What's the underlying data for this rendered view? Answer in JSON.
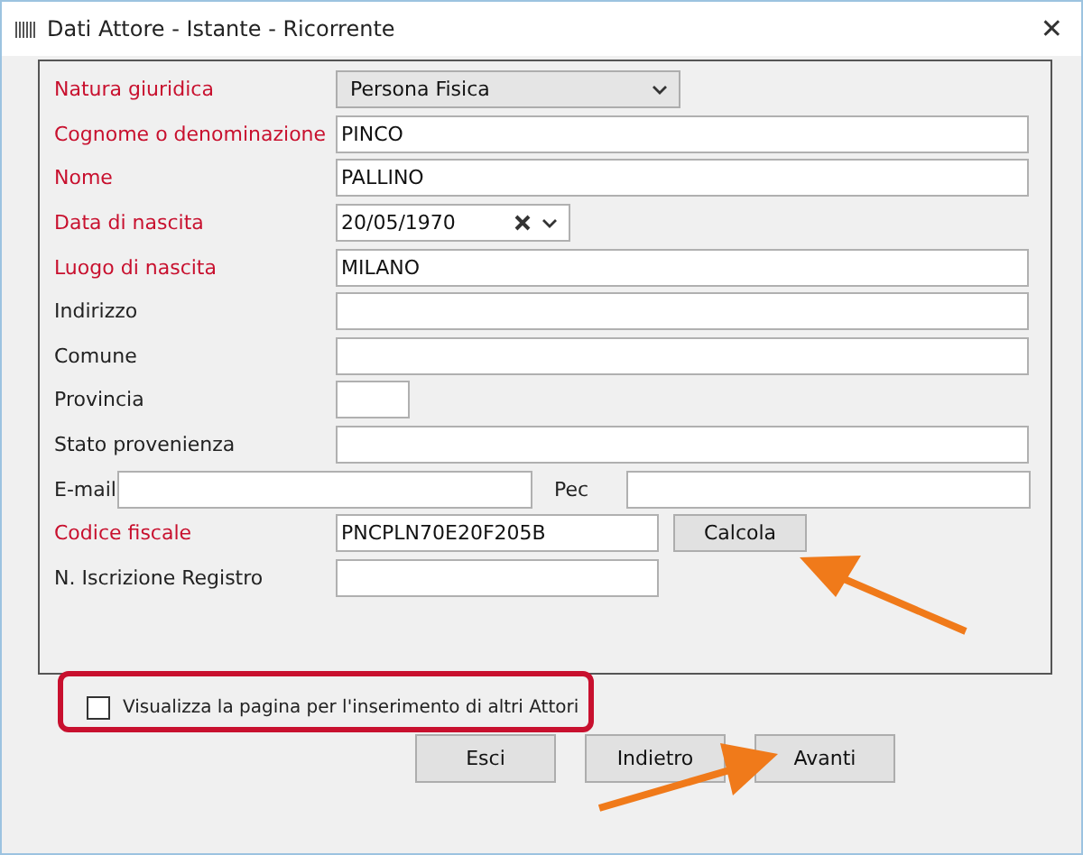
{
  "window": {
    "title": "Dati Attore - Istante - Ricorrente",
    "close": "✕"
  },
  "fields": [
    {
      "kind": "select",
      "label": "Natura giuridica",
      "required": true,
      "value": "Persona Fisica"
    },
    {
      "kind": "text",
      "label": "Cognome o denominazione",
      "required": true,
      "value": "PINCO"
    },
    {
      "kind": "text",
      "label": "Nome",
      "required": true,
      "value": "PALLINO"
    },
    {
      "kind": "date",
      "label": "Data di nascita",
      "required": true,
      "value": "20/05/1970"
    },
    {
      "kind": "text",
      "label": "Luogo di nascita",
      "required": true,
      "value": "MILANO"
    },
    {
      "kind": "text",
      "label": "Indirizzo",
      "required": false
    },
    {
      "kind": "text",
      "label": "Comune",
      "required": false
    },
    {
      "kind": "short",
      "label": "Provincia",
      "required": false
    },
    {
      "kind": "text",
      "label": "Stato provenienza",
      "required": false
    },
    {
      "kind": "pair",
      "label": "E-mail",
      "required": false,
      "second_label": "Pec"
    },
    {
      "kind": "button",
      "label": "Codice fiscale",
      "required": true,
      "value": "PNCPLN70E20F205B",
      "button": "Calcola"
    },
    {
      "kind": "medium",
      "label": "N. Iscrizione Registro",
      "required": false
    }
  ],
  "option": {
    "label": "Visualizza la pagina per l'inserimento di altri Attori",
    "checked": false
  },
  "buttons": [
    "Esci",
    "Indietro",
    "Avanti"
  ]
}
